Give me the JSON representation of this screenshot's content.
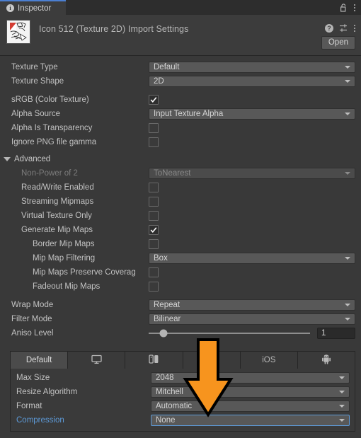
{
  "window": {
    "tab_label": "Inspector",
    "tab_icon": "info-icon",
    "lock_icon": "lock-open-icon",
    "menu_icon": "kebab-menu-icon"
  },
  "header": {
    "title": "Icon 512 (Texture 2D) Import Settings",
    "thumbnail_icon": "texture-thumbnail",
    "help_icon": "help-icon",
    "preset_icon": "preset-sliders-icon",
    "menu_icon": "kebab-menu-icon",
    "open_label": "Open"
  },
  "main": {
    "rows": [
      {
        "label": "Texture Type",
        "type": "dropdown",
        "value": "Default"
      },
      {
        "label": "Texture Shape",
        "type": "dropdown",
        "value": "2D"
      },
      {
        "label": "sRGB (Color Texture)",
        "type": "checkbox",
        "checked": true
      },
      {
        "label": "Alpha Source",
        "type": "dropdown",
        "value": "Input Texture Alpha"
      },
      {
        "label": "Alpha Is Transparency",
        "type": "checkbox",
        "checked": false
      },
      {
        "label": "Ignore PNG file gamma",
        "type": "checkbox",
        "checked": false
      }
    ],
    "advanced": {
      "label": "Advanced",
      "expanded": true,
      "rows": [
        {
          "label": "Non-Power of 2",
          "type": "dropdown",
          "value": "ToNearest",
          "disabled": true,
          "indent": 1
        },
        {
          "label": "Read/Write Enabled",
          "type": "checkbox",
          "checked": false,
          "indent": 1
        },
        {
          "label": "Streaming Mipmaps",
          "type": "checkbox",
          "checked": false,
          "indent": 1
        },
        {
          "label": "Virtual Texture Only",
          "type": "checkbox",
          "checked": false,
          "indent": 1
        },
        {
          "label": "Generate Mip Maps",
          "type": "checkbox",
          "checked": true,
          "indent": 1
        },
        {
          "label": "Border Mip Maps",
          "type": "checkbox",
          "checked": false,
          "indent": 2
        },
        {
          "label": "Mip Map Filtering",
          "type": "dropdown",
          "value": "Box",
          "indent": 2
        },
        {
          "label": "Mip Maps Preserve Coverag",
          "type": "checkbox",
          "checked": false,
          "indent": 2
        },
        {
          "label": "Fadeout Mip Maps",
          "type": "checkbox",
          "checked": false,
          "indent": 2
        }
      ]
    },
    "wrap": [
      {
        "label": "Wrap Mode",
        "type": "dropdown",
        "value": "Repeat"
      },
      {
        "label": "Filter Mode",
        "type": "dropdown",
        "value": "Bilinear"
      }
    ],
    "aniso": {
      "label": "Aniso Level",
      "value": "1",
      "slider_percent": 9
    }
  },
  "platform_panel": {
    "tabs": [
      {
        "label": "Default",
        "icon": "",
        "active": true
      },
      {
        "label": "",
        "icon": "monitor-icon",
        "active": false
      },
      {
        "label": "",
        "icon": "switch-icon",
        "active": false
      },
      {
        "label": "",
        "icon": "playstation-icon",
        "active": false
      },
      {
        "label": "iOS",
        "icon": "",
        "active": false
      },
      {
        "label": "",
        "icon": "android-icon",
        "active": false
      }
    ],
    "rows": [
      {
        "label": "Max Size",
        "value": "2048",
        "highlight": false
      },
      {
        "label": "Resize Algorithm",
        "value": "Mitchell",
        "highlight": false
      },
      {
        "label": "Format",
        "value": "Automatic",
        "highlight": false
      },
      {
        "label": "Compression",
        "value": "None",
        "highlight": true
      }
    ]
  },
  "annotation": {
    "arrow_icon": "down-arrow-annotation",
    "color": "#F7941E",
    "outline": "#000000"
  }
}
